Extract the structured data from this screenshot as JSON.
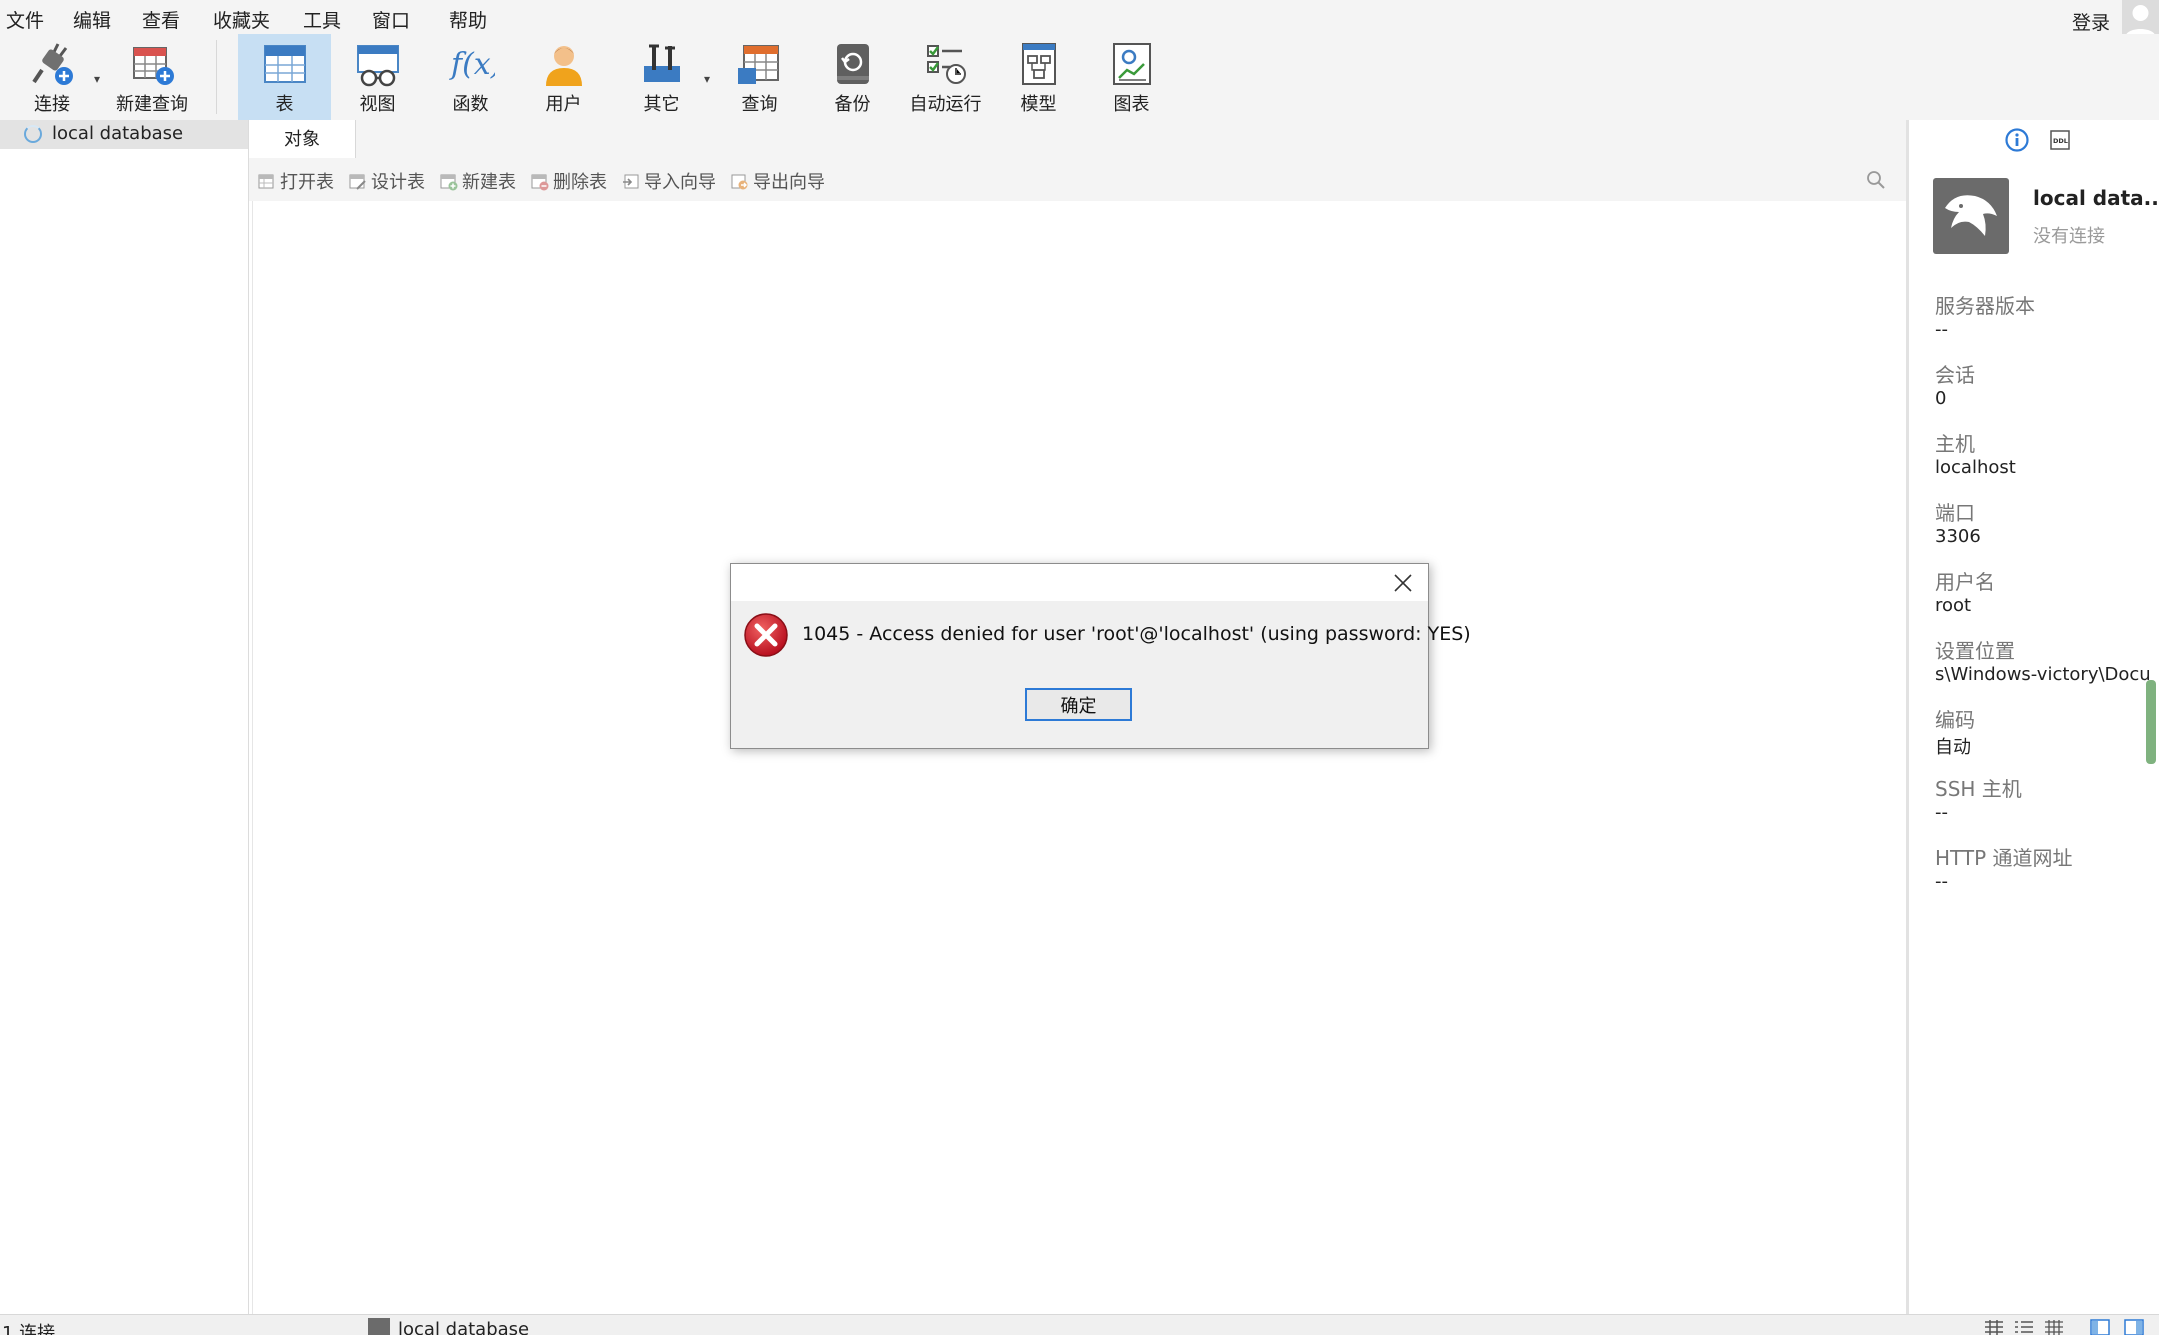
{
  "menu": [
    "文件",
    "编辑",
    "查看",
    "收藏夹",
    "工具",
    "窗口",
    "帮助"
  ],
  "login_label": "登录",
  "toolbar": {
    "connect": "连接",
    "new_query": "新建查询",
    "table": "表",
    "view": "视图",
    "function": "函数",
    "user": "用户",
    "other": "其它",
    "query": "查询",
    "backup": "备份",
    "automation": "自动运行",
    "model": "模型",
    "chart": "图表"
  },
  "left_panel": {
    "connection_name": "local database"
  },
  "tabs": {
    "objects": "对象"
  },
  "object_toolbar": {
    "open_table": "打开表",
    "design_table": "设计表",
    "new_table": "新建表",
    "delete_table": "删除表",
    "import_wizard": "导入向导",
    "export_wizard": "导出向导"
  },
  "right_panel": {
    "name": "local data...",
    "status": "没有连接",
    "props": [
      {
        "label": "服务器版本",
        "value": "--"
      },
      {
        "label": "会话",
        "value": "0"
      },
      {
        "label": "主机",
        "value": "localhost"
      },
      {
        "label": "端口",
        "value": "3306"
      },
      {
        "label": "用户名",
        "value": "root"
      },
      {
        "label": "设置位置",
        "value": "s\\Windows-victory\\Docu"
      },
      {
        "label": "编码",
        "value": "自动"
      },
      {
        "label": "SSH 主机",
        "value": "--"
      },
      {
        "label": "HTTP 通道网址",
        "value": "--"
      }
    ]
  },
  "dialog": {
    "message": "1045 - Access denied for user 'root'@'localhost' (using password: YES)",
    "ok": "确定"
  },
  "status_bar": {
    "count": "1 连接",
    "connection": "local database"
  },
  "colors": {
    "accent_blue": "#2d7ad6",
    "toolbar_active": "#c7dff3",
    "error_red": "#c8102e"
  }
}
